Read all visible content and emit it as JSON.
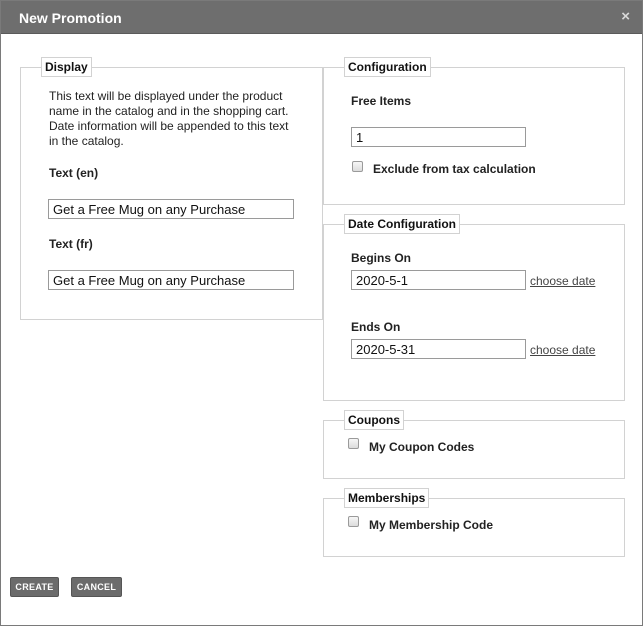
{
  "dialog": {
    "title": "New Promotion",
    "close_glyph": "×"
  },
  "display": {
    "legend": "Display",
    "description": "This text will be displayed under the product name in the catalog and in the shopping cart. Date information will be appended to this text in the catalog.",
    "text_en_label": "Text (en)",
    "text_en_value": "Get a Free Mug on any Purchase",
    "text_fr_label": "Text (fr)",
    "text_fr_value": "Get a Free Mug on any Purchase"
  },
  "configuration": {
    "legend": "Configuration",
    "free_items_label": "Free Items",
    "free_items_value": "1",
    "exclude_tax_label": "Exclude from tax calculation"
  },
  "date_configuration": {
    "legend": "Date Configuration",
    "begins_label": "Begins On",
    "begins_value": "2020-5-1",
    "ends_label": "Ends On",
    "ends_value": "2020-5-31",
    "choose_date_label": "choose date"
  },
  "coupons": {
    "legend": "Coupons",
    "item_label": "My Coupon Codes"
  },
  "memberships": {
    "legend": "Memberships",
    "item_label": "My Membership Code"
  },
  "buttons": {
    "create": "CREATE",
    "cancel": "CANCEL"
  }
}
